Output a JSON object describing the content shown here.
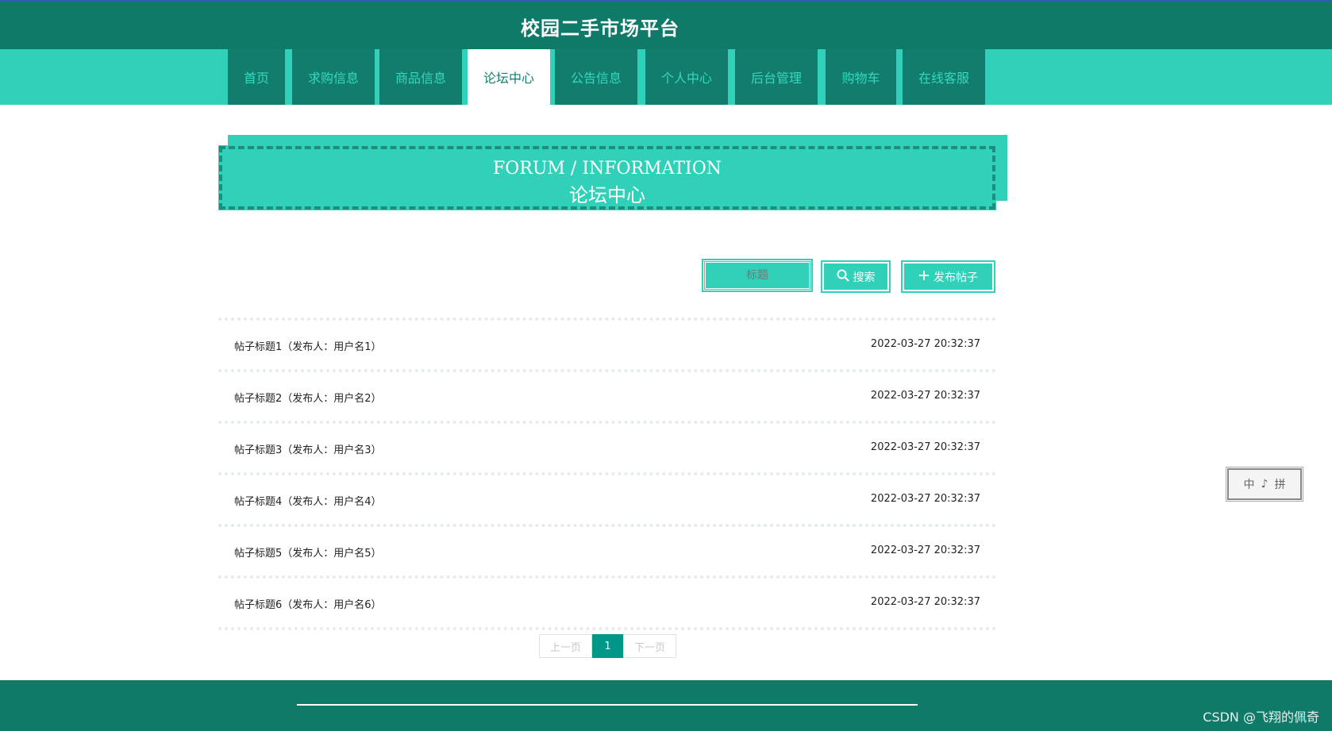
{
  "header": {
    "title": "校园二手市场平台"
  },
  "nav": {
    "items": [
      {
        "label": "首页"
      },
      {
        "label": "求购信息"
      },
      {
        "label": "商品信息"
      },
      {
        "label": "论坛中心"
      },
      {
        "label": "公告信息"
      },
      {
        "label": "个人中心"
      },
      {
        "label": "后台管理"
      },
      {
        "label": "购物车"
      },
      {
        "label": "在线客服"
      }
    ],
    "active_index": 3
  },
  "banner": {
    "en": "FORUM / INFORMATION",
    "cn": "论坛中心"
  },
  "toolbar": {
    "search_placeholder": "标题",
    "search_label": "搜索",
    "post_label": "发布帖子"
  },
  "posts": [
    {
      "title": "帖子标题1（发布人：用户名1）",
      "date": "2022-03-27 20:32:37"
    },
    {
      "title": "帖子标题2（发布人：用户名2）",
      "date": "2022-03-27 20:32:37"
    },
    {
      "title": "帖子标题3（发布人：用户名3）",
      "date": "2022-03-27 20:32:37"
    },
    {
      "title": "帖子标题4（发布人：用户名4）",
      "date": "2022-03-27 20:32:37"
    },
    {
      "title": "帖子标题5（发布人：用户名5）",
      "date": "2022-03-27 20:32:37"
    },
    {
      "title": "帖子标题6（发布人：用户名6）",
      "date": "2022-03-27 20:32:37"
    }
  ],
  "pager": {
    "prev": "上一页",
    "current": "1",
    "next": "下一页"
  },
  "ime": {
    "chars": [
      "中",
      "♪",
      "拼"
    ]
  },
  "watermark": "CSDN @飞翔的佩奇",
  "colors": {
    "primary": "#107a69",
    "accent": "#31d1b9",
    "page_active": "#009688"
  }
}
